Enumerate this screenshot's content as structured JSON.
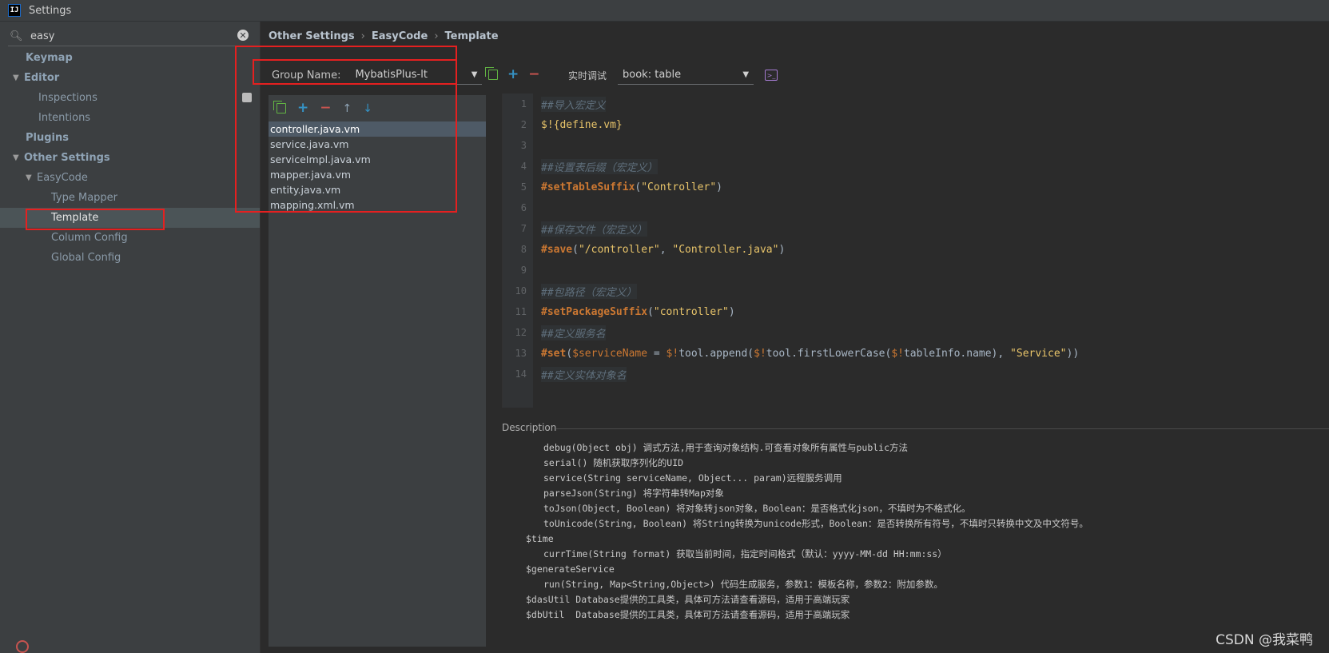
{
  "window": {
    "title": "Settings",
    "app_icon": "IJ"
  },
  "search": {
    "value": "easy"
  },
  "tree": {
    "keymap": "Keymap",
    "editor": "Editor",
    "inspections": "Inspections",
    "intentions": "Intentions",
    "plugins": "Plugins",
    "other_settings": "Other Settings",
    "easycode": "EasyCode",
    "type_mapper": "Type Mapper",
    "template": "Template",
    "column_config": "Column Config",
    "global_config": "Global Config"
  },
  "breadcrumb": [
    "Other Settings",
    "EasyCode",
    "Template"
  ],
  "group": {
    "label": "Group Name:",
    "value": "MybatisPlus-lt"
  },
  "debug": {
    "label": "实时调试",
    "value": "book: table"
  },
  "files": [
    "controller.java.vm",
    "service.java.vm",
    "serviceImpl.java.vm",
    "mapper.java.vm",
    "entity.java.vm",
    "mapping.xml.vm"
  ],
  "selected_file": "controller.java.vm",
  "code": {
    "line_numbers": [
      "1",
      "2",
      "3",
      "4",
      "5",
      "6",
      "7",
      "8",
      "9",
      "10",
      "11",
      "12",
      "13",
      "14"
    ],
    "l1": "##导入宏定义",
    "l2": "$!{define.vm}",
    "l4": "##设置表后缀（宏定义）",
    "l5_dir": "#setTableSuffix",
    "l5_a": "(",
    "l5_str": "\"Controller\"",
    "l5_b": ")",
    "l7": "##保存文件（宏定义）",
    "l8_dir": "#save",
    "l8_a": "(",
    "l8_s1": "\"/controller\"",
    "l8_c": ", ",
    "l8_s2": "\"Controller.java\"",
    "l8_b": ")",
    "l10": "##包路径（宏定义）",
    "l11_dir": "#setPackageSuffix",
    "l11_a": "(",
    "l11_str": "\"controller\"",
    "l11_b": ")",
    "l12": "##定义服务名",
    "l13_dir": "#set",
    "l13_a": "(",
    "l13_v1": "$serviceName",
    "l13_b": " = ",
    "l13_v2": "$!",
    "l13_c": "tool.append(",
    "l13_v3": "$!",
    "l13_d": "tool.firstLowerCase(",
    "l13_v4": "$!",
    "l13_e": "tableInfo.name), ",
    "l13_str": "\"Service\"",
    "l13_f": "))",
    "l14": "##定义实体对象名"
  },
  "description": {
    "label": "Description",
    "lines": [
      "debug(Object obj) 调式方法,用于查询对象结构.可查看对象所有属性与public方法",
      "serial() 随机获取序列化的UID",
      "service(String serviceName, Object... param)远程服务调用",
      "parseJson(String) 将字符串转Map对象",
      "toJson(Object, Boolean) 将对象转json对象，Boolean：是否格式化json，不填时为不格式化。",
      "toUnicode(String, Boolean) 将String转换为unicode形式，Boolean：是否转换所有符号，不填时只转换中文及中文符号。",
      "$time",
      "currTime(String format) 获取当前时间，指定时间格式（默认：yyyy-MM-dd HH:mm:ss）",
      "$generateService",
      "run(String, Map<String,Object>) 代码生成服务，参数1：模板名称，参数2：附加参数。",
      "$dasUtil Database提供的工具类，具体可方法请查看源码，适用于高端玩家",
      "$dbUtil  Database提供的工具类，具体可方法请查看源码，适用于高端玩家"
    ]
  },
  "watermark": "CSDN @我菜鸭",
  "colors": {
    "highlight_box": "#e52020",
    "accent_blue": "#3592c4",
    "accent_green": "#62b543",
    "accent_red": "#c75450"
  }
}
